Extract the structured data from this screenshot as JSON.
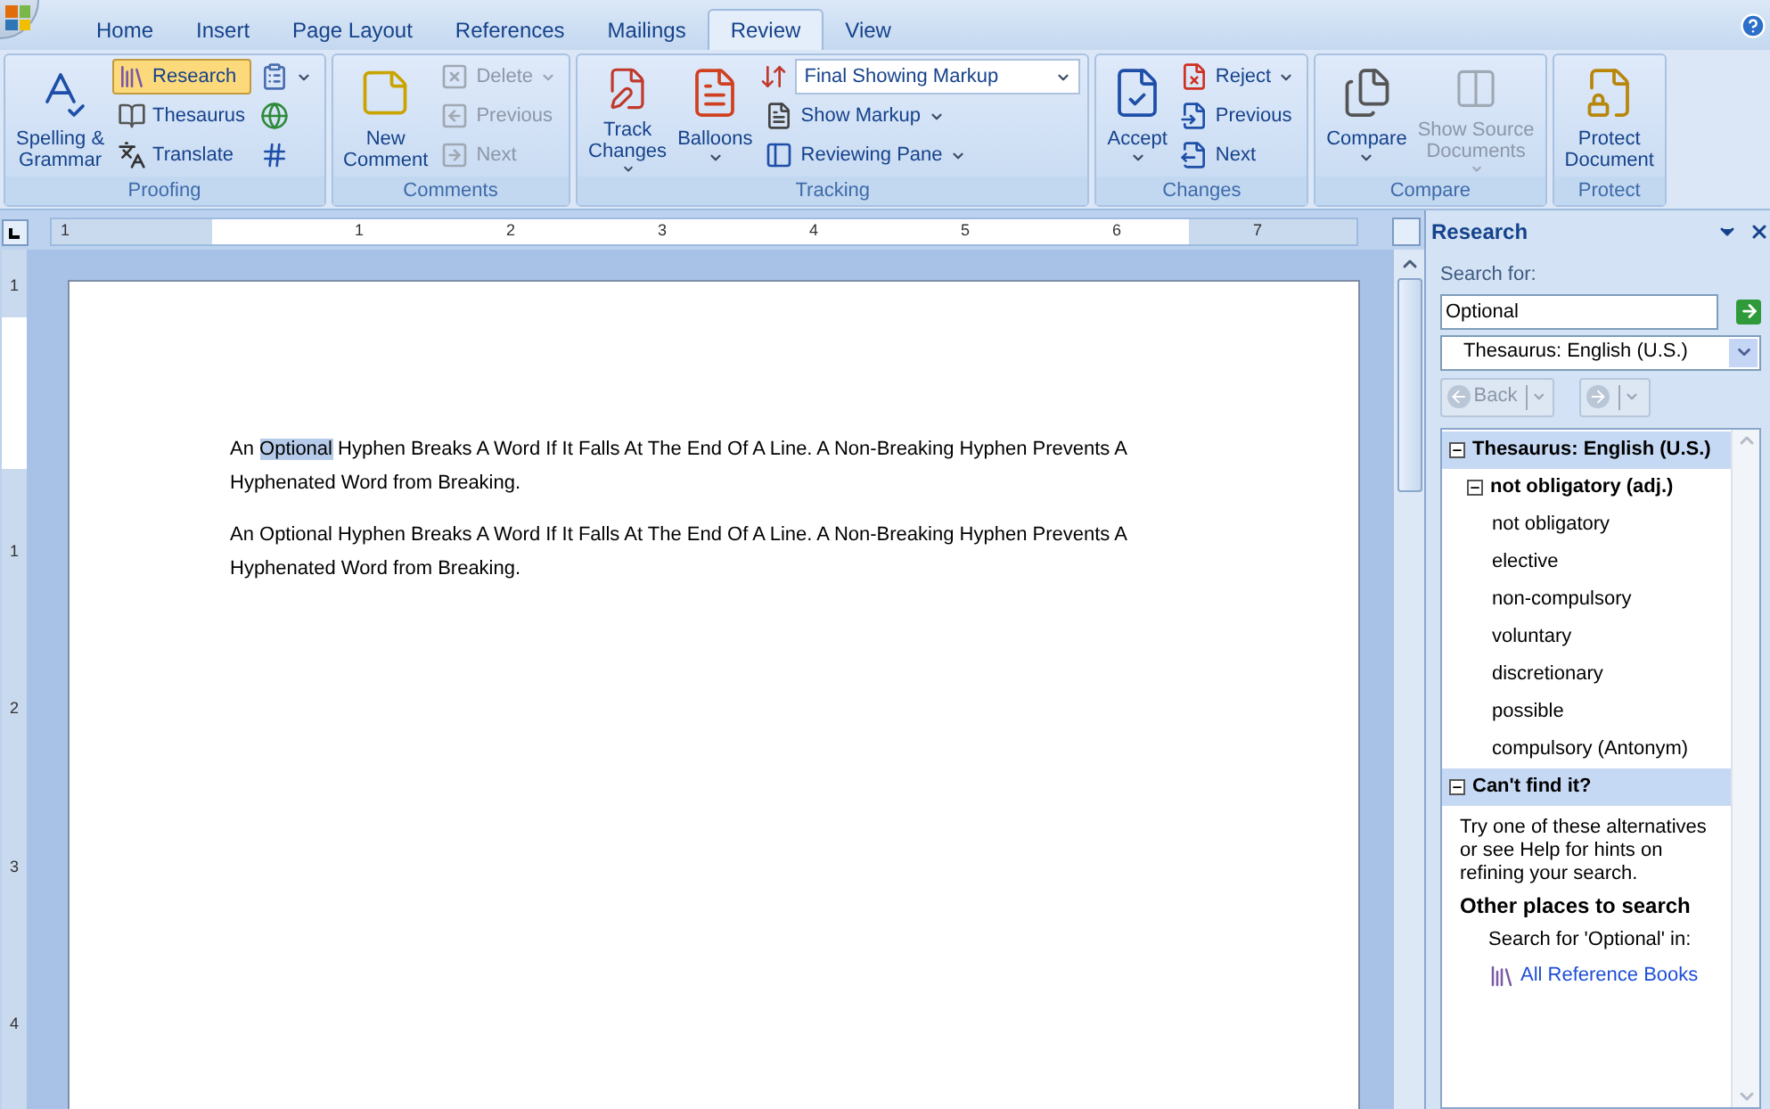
{
  "tabs": [
    {
      "label": "Home",
      "selected": false
    },
    {
      "label": "Insert",
      "selected": false
    },
    {
      "label": "Page Layout",
      "selected": false
    },
    {
      "label": "References",
      "selected": false
    },
    {
      "label": "Mailings",
      "selected": false
    },
    {
      "label": "Review",
      "selected": true
    },
    {
      "label": "View",
      "selected": false
    }
  ],
  "ribbon": [
    {
      "name": "Proofing",
      "items": [
        {
          "kind": "large",
          "label": "Spelling &\nGrammar",
          "disabled": false,
          "dropdown": false
        },
        {
          "kind": "small",
          "label": "Research",
          "disabled": false,
          "dropdown": false,
          "on": true
        },
        {
          "kind": "small",
          "label": "Thesaurus",
          "disabled": false,
          "dropdown": false,
          "on": false
        },
        {
          "kind": "small",
          "label": "Translate",
          "disabled": false,
          "dropdown": false,
          "on": false
        },
        {
          "kind": "icon",
          "disabled": false,
          "dropdown": true,
          "on": false
        },
        {
          "kind": "icon",
          "disabled": false,
          "dropdown": false,
          "on": false
        },
        {
          "kind": "icon",
          "disabled": false,
          "dropdown": false,
          "on": false
        }
      ]
    },
    {
      "name": "Comments",
      "items": [
        {
          "kind": "large",
          "label": "New\nComment",
          "disabled": false,
          "dropdown": false
        },
        {
          "kind": "small",
          "label": "Delete",
          "disabled": true,
          "dropdown": true,
          "on": false
        },
        {
          "kind": "small",
          "label": "Previous",
          "disabled": true,
          "dropdown": false,
          "on": false
        },
        {
          "kind": "small",
          "label": "Next",
          "disabled": true,
          "dropdown": false,
          "on": false
        }
      ]
    },
    {
      "name": "Tracking",
      "items": [
        {
          "kind": "large",
          "label": "Track\nChanges",
          "disabled": false,
          "dropdown": true
        },
        {
          "kind": "large",
          "label": "Balloons",
          "disabled": false,
          "dropdown": true
        },
        {
          "kind": "combo",
          "label": "Final Showing Markup",
          "disabled": false,
          "dropdown": true
        },
        {
          "kind": "small",
          "label": "Show Markup",
          "disabled": false,
          "dropdown": true,
          "on": false
        },
        {
          "kind": "small",
          "label": "Reviewing Pane",
          "disabled": false,
          "dropdown": true,
          "on": false
        }
      ]
    },
    {
      "name": "Changes",
      "items": [
        {
          "kind": "large",
          "label": "Accept",
          "disabled": false,
          "dropdown": true
        },
        {
          "kind": "small",
          "label": "Reject",
          "disabled": false,
          "dropdown": true,
          "on": false
        },
        {
          "kind": "small",
          "label": "Previous",
          "disabled": false,
          "dropdown": false,
          "on": false
        },
        {
          "kind": "small",
          "label": "Next",
          "disabled": false,
          "dropdown": false,
          "on": false
        }
      ]
    },
    {
      "name": "Compare",
      "items": [
        {
          "kind": "large",
          "label": "Compare",
          "disabled": false,
          "dropdown": true
        },
        {
          "kind": "large",
          "label": "Show Source\nDocuments",
          "disabled": true,
          "dropdown": true
        }
      ]
    },
    {
      "name": "Protect",
      "items": [
        {
          "kind": "large",
          "label": "Protect\nDocument",
          "disabled": false,
          "dropdown": false
        }
      ]
    }
  ],
  "ruler": {
    "labels": [
      "1",
      "1",
      "2",
      "3",
      "4",
      "5",
      "6",
      "7"
    ],
    "vertical_labels": [
      "1",
      "1",
      "2",
      "3",
      "4"
    ]
  },
  "document": {
    "paragraphs": [
      {
        "parts": [
          {
            "text": "An ",
            "selected": false
          },
          {
            "text": "Optional",
            "selected": true
          },
          {
            "text": " Hyphen Breaks A Word If It Falls At The End Of A Line. A Non-Breaking Hyphen Prevents A Hyphenated Word from Breaking.",
            "selected": false
          }
        ]
      },
      {
        "parts": [
          {
            "text": "An Optional Hyphen Breaks A Word If It Falls At The End Of A Line. A Non-Breaking Hyphen Prevents A Hyphenated Word from Breaking.",
            "selected": false
          }
        ]
      }
    ]
  },
  "research": {
    "title": "Research",
    "search_label": "Search for:",
    "search_value": "Optional",
    "source": "Thesaurus: English (U.S.)",
    "back": {
      "label": "Back",
      "disabled": true
    },
    "forward": {
      "disabled": true
    },
    "results": [
      {
        "label": "Thesaurus: English (U.S.)",
        "expanded": true,
        "children": [
          {
            "label": "not obligatory (adj.)",
            "expanded": true,
            "children": [
              {
                "label": "not obligatory"
              },
              {
                "label": "elective"
              },
              {
                "label": "non-compulsory"
              },
              {
                "label": "voluntary"
              },
              {
                "label": "discretionary"
              },
              {
                "label": "possible"
              },
              {
                "label": "compulsory (Antonym)"
              }
            ]
          }
        ]
      },
      {
        "label": "Can't find it?",
        "expanded": true
      }
    ],
    "hint": "Try one of these alternatives or see Help for hints on refining your search.",
    "other_heading": "Other places to search",
    "search_in": "Search for 'Optional' in:",
    "link": "All Reference Books"
  }
}
